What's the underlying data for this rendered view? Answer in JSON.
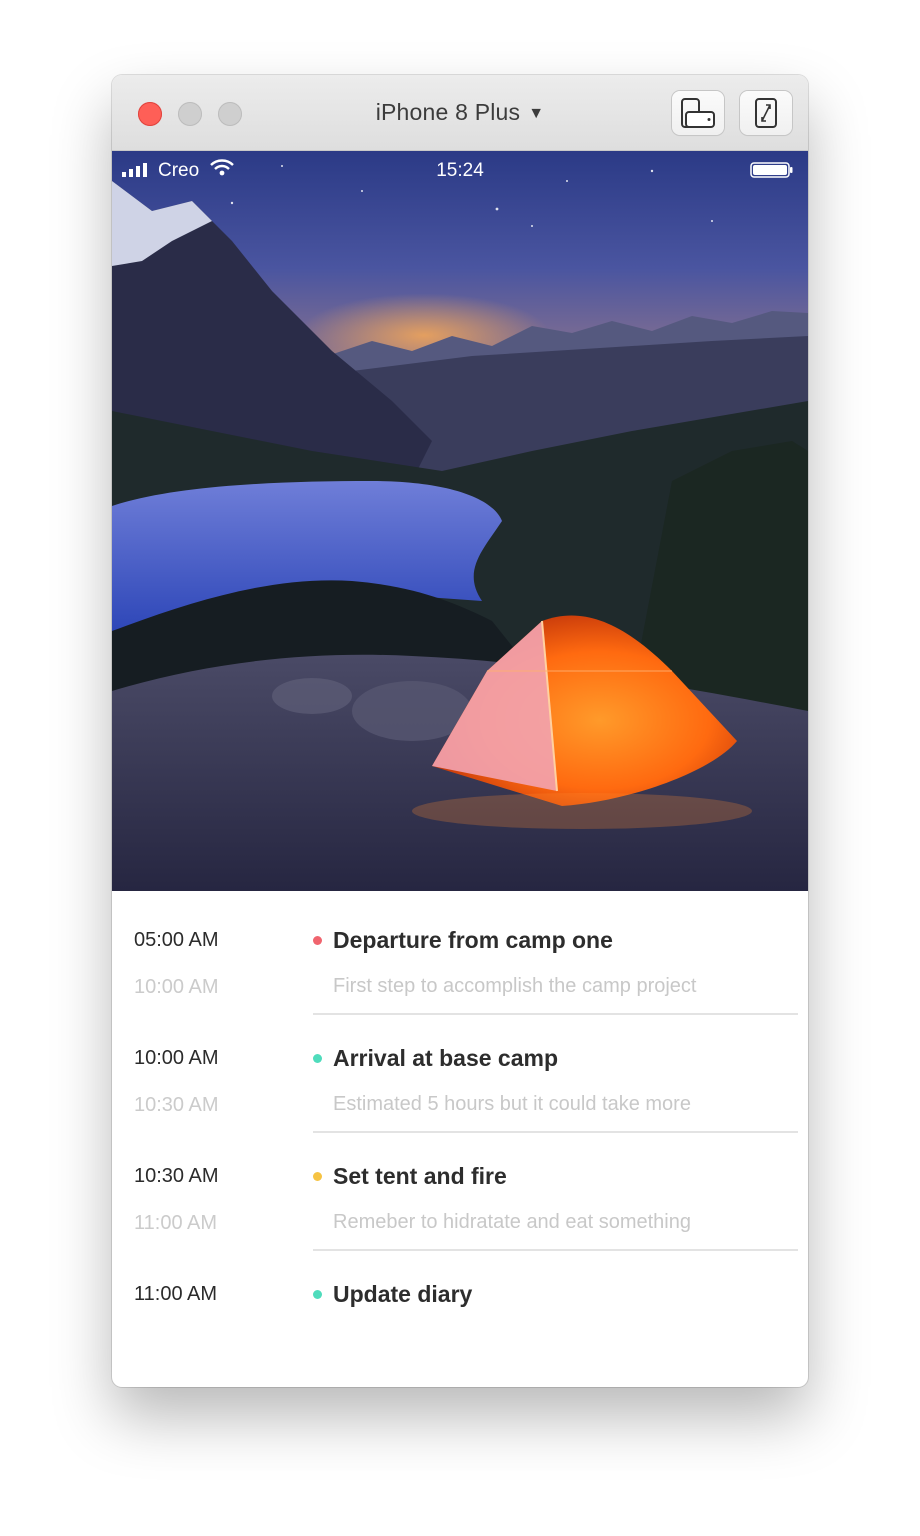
{
  "window": {
    "device_name": "iPhone 8 Plus",
    "device_caret": "▼",
    "toolbar_icons": [
      "device-rotate-icon",
      "resize-icon"
    ]
  },
  "status_bar": {
    "carrier": "Creo",
    "time": "15:24"
  },
  "timeline": [
    {
      "start": "05:00 AM",
      "end": "10:00 AM",
      "title": "Departure from camp one",
      "subtitle": "First step to accomplish the camp project",
      "dot_color": "#f0646e"
    },
    {
      "start": "10:00 AM",
      "end": "10:30 AM",
      "title": "Arrival at base camp",
      "subtitle": "Estimated 5 hours but it could take more",
      "dot_color": "#4fdcbc"
    },
    {
      "start": "10:30 AM",
      "end": "11:00 AM",
      "title": "Set tent and fire",
      "subtitle": "Remeber to hidratate and eat something",
      "dot_color": "#f6c343"
    },
    {
      "start": "11:00 AM",
      "title": "Update diary",
      "dot_color": "#4fdcbc"
    }
  ]
}
